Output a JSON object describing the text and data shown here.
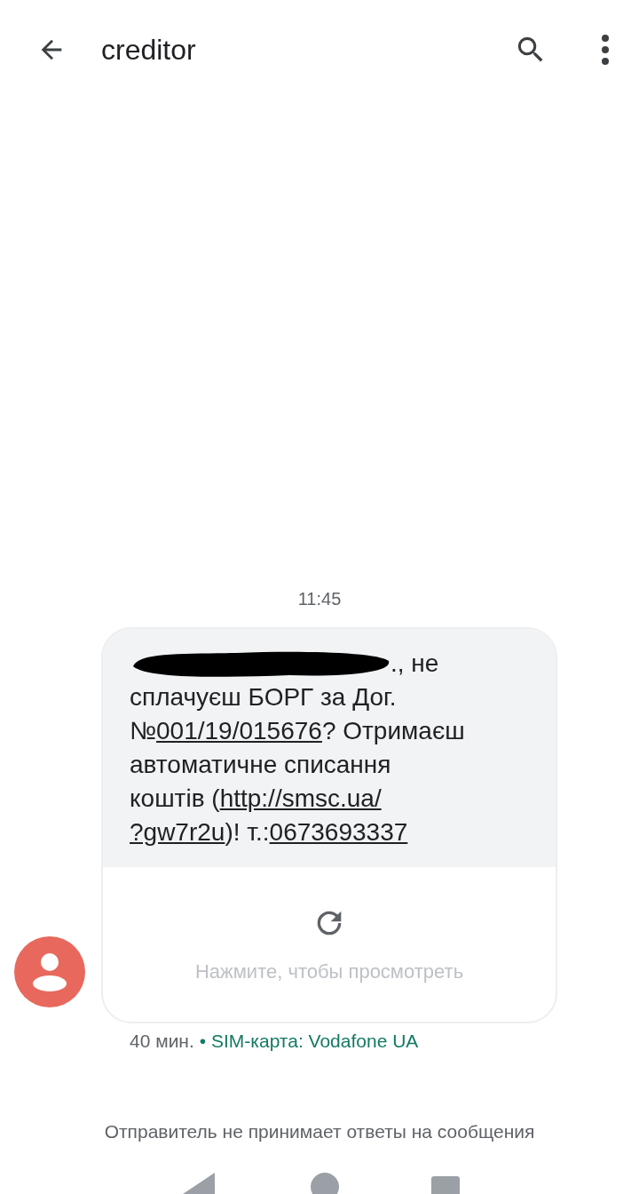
{
  "app_bar": {
    "title": "creditor"
  },
  "message": {
    "time": "11:45",
    "redacted": true,
    "lines": [
      [
        {
          "text": "., не",
          "link": false
        }
      ],
      [
        {
          "text": "сплачуєш БОРГ за Дог.",
          "link": false
        }
      ],
      [
        {
          "text": "№",
          "link": false
        },
        {
          "text": "001/19/015676",
          "link": true
        },
        {
          "text": "? Отримаєш",
          "link": false
        }
      ],
      [
        {
          "text": "автоматичне списання",
          "link": false
        }
      ],
      [
        {
          "text": "коштів (",
          "link": false
        },
        {
          "text": "http://smsc.ua/",
          "link": true
        }
      ],
      [
        {
          "text": "?gw7r2u",
          "link": true
        },
        {
          "text": ")! т.:",
          "link": false
        },
        {
          "text": "0673693337",
          "link": true
        }
      ]
    ],
    "preview_hint": "Нажмите, чтобы просмотреть",
    "age": "40 мин.",
    "sim": "• SIM-карта: Vodafone UA"
  },
  "footer_note": "Отправитель не принимает ответы на сообщения"
}
